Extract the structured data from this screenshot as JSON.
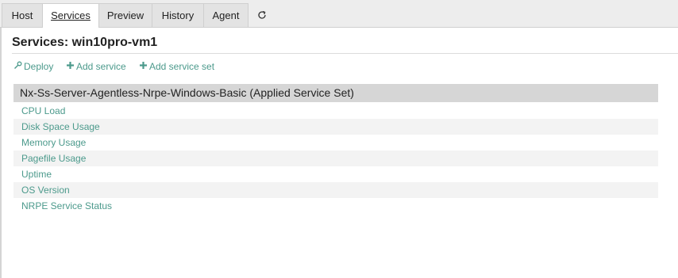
{
  "tabs": [
    {
      "label": "Host"
    },
    {
      "label": "Services",
      "active": true
    },
    {
      "label": "Preview"
    },
    {
      "label": "History"
    },
    {
      "label": "Agent"
    }
  ],
  "refresh_icon": "refresh-icon",
  "page": {
    "title": "Services: win10pro-vm1"
  },
  "toolbar": {
    "deploy_label": "Deploy",
    "deploy_icon": "wrench-icon",
    "add_service_label": "Add service",
    "add_service_icon": "plus-icon",
    "add_service_set_label": "Add service set",
    "add_service_set_icon": "plus-icon"
  },
  "service_set": {
    "title": "Nx-Ss-Server-Agentless-Nrpe-Windows-Basic (Applied Service Set)",
    "services": [
      "CPU Load",
      "Disk Space Usage",
      "Memory Usage",
      "Pagefile Usage",
      "Uptime",
      "OS Version",
      "NRPE Service Status"
    ]
  },
  "colors": {
    "link": "#4c9a8c",
    "header_bg": "#d6d6d6",
    "tab_bar_bg": "#ededed"
  }
}
